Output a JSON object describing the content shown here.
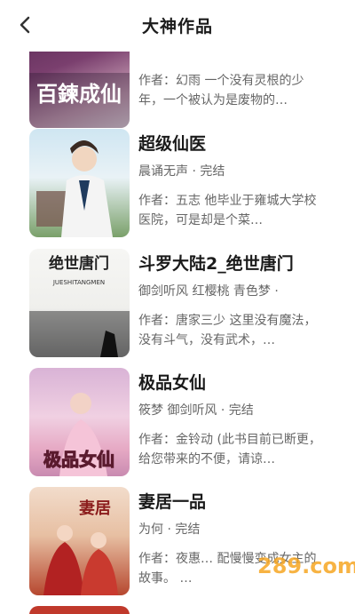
{
  "header": {
    "title": "大神作品",
    "back_icon": "back-arrow-icon"
  },
  "books": [
    {
      "cover_text": "百鍊成仙",
      "name": "",
      "meta": "",
      "desc": "作者：幻雨 一个没有灵根的少年，一个被认为是废物的…"
    },
    {
      "cover_text": "",
      "name": "超级仙医",
      "meta": "晨诵无声 · 完结",
      "desc": "作者：五志 他毕业于雍城大学校医院，可是却是个菜…"
    },
    {
      "cover_text": "绝世唐门",
      "cover_sub": "JUESHITANGMEN",
      "name": "斗罗大陆2_绝世唐门",
      "meta": "御剑听风 红樱桃 青色梦 ·",
      "desc": "作者：唐家三少 这里没有魔法，没有斗气，没有武术，…"
    },
    {
      "cover_text": "极品女仙",
      "name": "极品女仙",
      "meta": "筱梦 御剑听风 · 完结",
      "desc": "作者：金铃动 (此书目前已断更，给您带来的不便，请谅…"
    },
    {
      "cover_text": "妻居",
      "name": "妻居一品",
      "meta": "为何 · 完结",
      "desc": "作者：夜惠… 配慢慢变成女主的故事。 …"
    }
  ],
  "watermark": "289.com"
}
